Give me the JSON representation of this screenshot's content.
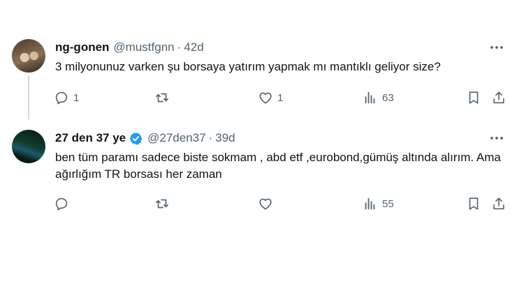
{
  "tweets": [
    {
      "name": "ng-gonen",
      "handle": "@mustfgnn",
      "separator": "·",
      "time": "42d",
      "verified": false,
      "text": "3 milyonunuz varken şu borsaya yatırım yapmak mı mantıklı geliyor size?",
      "reply_count": "1",
      "retweet_count": "",
      "like_count": "1",
      "view_count": "63"
    },
    {
      "name": "27 den 37 ye",
      "handle": "@27den37",
      "separator": "·",
      "time": "39d",
      "verified": true,
      "text": "ben tüm paramı sadece biste sokmam , abd etf ,eurobond,gümüş altında alırım. Ama ağırlığım TR borsası her zaman",
      "reply_count": "",
      "retweet_count": "",
      "like_count": "",
      "view_count": "55"
    }
  ],
  "colors": {
    "text_primary": "#0f1419",
    "text_secondary": "#536471",
    "verified_badge": "#1d9bf0",
    "thread_line": "#cfd9de"
  },
  "icons": [
    "reply-icon",
    "retweet-icon",
    "like-icon",
    "views-icon",
    "bookmark-icon",
    "share-icon",
    "more-icon",
    "verified-badge-icon"
  ]
}
